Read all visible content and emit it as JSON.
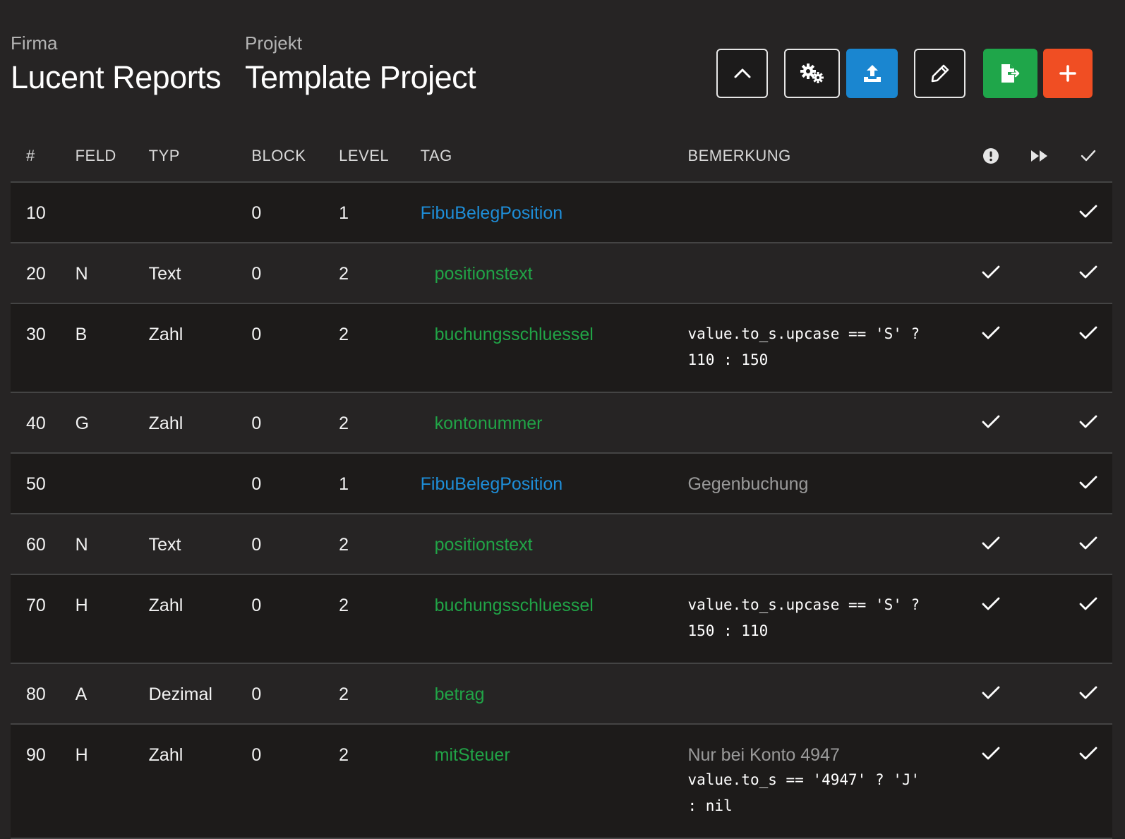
{
  "header": {
    "company_label": "Firma",
    "company_name": "Lucent Reports",
    "project_label": "Projekt",
    "project_name": "Template Project"
  },
  "toolbar": {
    "buttons": [
      {
        "icon": "chevron-up-icon",
        "style": "outline"
      },
      {
        "icon": "cogs-icon",
        "style": "outline"
      },
      {
        "icon": "upload-icon",
        "style": "primary",
        "color": "#1a86d0"
      },
      {
        "icon": "pencil-icon",
        "style": "outline"
      },
      {
        "icon": "file-export-icon",
        "style": "success",
        "color": "#1fa64a"
      },
      {
        "icon": "plus-icon",
        "style": "danger",
        "color": "#f04e23"
      }
    ]
  },
  "table": {
    "columns": {
      "num": "#",
      "field": "FELD",
      "type": "TYP",
      "block": "BLOCK",
      "level": "LEVEL",
      "tag": "TAG",
      "note": "BEMERKUNG",
      "icon_cols": [
        "exclamation-circle-icon",
        "fast-forward-icon",
        "check-icon"
      ]
    },
    "rows": [
      {
        "num": "10",
        "field": "",
        "type": "",
        "block": "0",
        "level": "1",
        "tag": "FibuBelegPosition",
        "tag_kind": "block",
        "note": "",
        "code": "",
        "warn_check": false,
        "skip_check": true
      },
      {
        "num": "20",
        "field": "N",
        "type": "Text",
        "block": "0",
        "level": "2",
        "tag": "positionstext",
        "tag_kind": "field",
        "note": "",
        "code": "",
        "warn_check": true,
        "skip_check": true
      },
      {
        "num": "30",
        "field": "B",
        "type": "Zahl",
        "block": "0",
        "level": "2",
        "tag": "buchungsschluessel",
        "tag_kind": "field",
        "note": "",
        "code": "value.to_s.upcase == 'S' ?\n110 : 150",
        "warn_check": true,
        "skip_check": true
      },
      {
        "num": "40",
        "field": "G",
        "type": "Zahl",
        "block": "0",
        "level": "2",
        "tag": "kontonummer",
        "tag_kind": "field",
        "note": "",
        "code": "",
        "warn_check": true,
        "skip_check": true
      },
      {
        "num": "50",
        "field": "",
        "type": "",
        "block": "0",
        "level": "1",
        "tag": "FibuBelegPosition",
        "tag_kind": "block",
        "note": "Gegenbuchung",
        "code": "",
        "warn_check": false,
        "skip_check": true
      },
      {
        "num": "60",
        "field": "N",
        "type": "Text",
        "block": "0",
        "level": "2",
        "tag": "positionstext",
        "tag_kind": "field",
        "note": "",
        "code": "",
        "warn_check": true,
        "skip_check": true
      },
      {
        "num": "70",
        "field": "H",
        "type": "Zahl",
        "block": "0",
        "level": "2",
        "tag": "buchungsschluessel",
        "tag_kind": "field",
        "note": "",
        "code": "value.to_s.upcase == 'S' ?\n150 : 110",
        "warn_check": true,
        "skip_check": true
      },
      {
        "num": "80",
        "field": "A",
        "type": "Dezimal",
        "block": "0",
        "level": "2",
        "tag": "betrag",
        "tag_kind": "field",
        "note": "",
        "code": "",
        "warn_check": true,
        "skip_check": true
      },
      {
        "num": "90",
        "field": "H",
        "type": "Zahl",
        "block": "0",
        "level": "2",
        "tag": "mitSteuer",
        "tag_kind": "field",
        "note": "Nur bei Konto 4947",
        "code": "value.to_s == '4947' ? 'J'\n: nil",
        "warn_check": true,
        "skip_check": true
      }
    ]
  },
  "colors": {
    "background": "#262424",
    "row_alt": "#1d1b1a",
    "tag_block": "#1e8ed8",
    "tag_field": "#21a447",
    "muted_note": "#9a9a9a"
  }
}
